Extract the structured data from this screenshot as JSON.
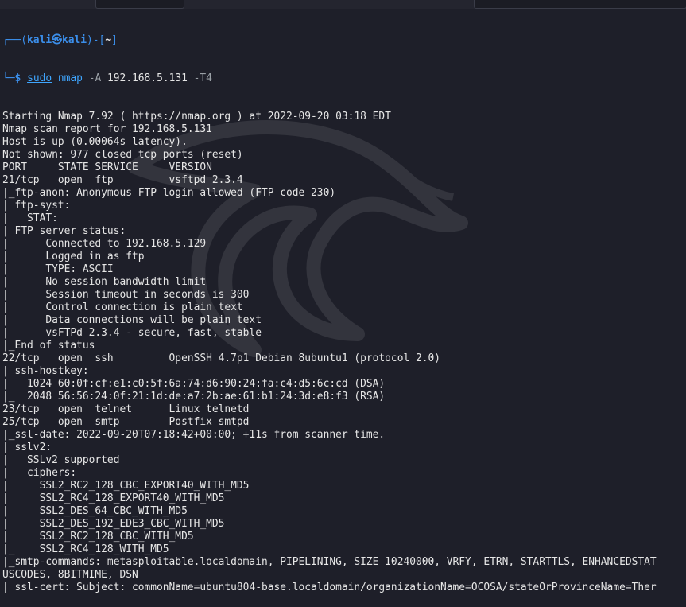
{
  "prompt": {
    "user": "kali",
    "at": "㉿",
    "host": "kali",
    "path": "~",
    "dollar": "$"
  },
  "command": {
    "sudo": "sudo",
    "binary": "nmap",
    "flag_a": "-A",
    "target": "192.168.5.131",
    "flag_t": "-T4"
  },
  "output_lines": [
    "Starting Nmap 7.92 ( https://nmap.org ) at 2022-09-20 03:18 EDT",
    "Nmap scan report for 192.168.5.131",
    "Host is up (0.00064s latency).",
    "Not shown: 977 closed tcp ports (reset)",
    "PORT     STATE SERVICE     VERSION",
    "21/tcp   open  ftp         vsftpd 2.3.4",
    "|_ftp-anon: Anonymous FTP login allowed (FTP code 230)",
    "| ftp-syst:",
    "|   STAT:",
    "| FTP server status:",
    "|      Connected to 192.168.5.129",
    "|      Logged in as ftp",
    "|      TYPE: ASCII",
    "|      No session bandwidth limit",
    "|      Session timeout in seconds is 300",
    "|      Control connection is plain text",
    "|      Data connections will be plain text",
    "|      vsFTPd 2.3.4 - secure, fast, stable",
    "|_End of status",
    "22/tcp   open  ssh         OpenSSH 4.7p1 Debian 8ubuntu1 (protocol 2.0)",
    "| ssh-hostkey:",
    "|   1024 60:0f:cf:e1:c0:5f:6a:74:d6:90:24:fa:c4:d5:6c:cd (DSA)",
    "|_  2048 56:56:24:0f:21:1d:de:a7:2b:ae:61:b1:24:3d:e8:f3 (RSA)",
    "23/tcp   open  telnet      Linux telnetd",
    "25/tcp   open  smtp        Postfix smtpd",
    "|_ssl-date: 2022-09-20T07:18:42+00:00; +11s from scanner time.",
    "| sslv2:",
    "|   SSLv2 supported",
    "|   ciphers:",
    "|     SSL2_RC2_128_CBC_EXPORT40_WITH_MD5",
    "|     SSL2_RC4_128_EXPORT40_WITH_MD5",
    "|     SSL2_DES_64_CBC_WITH_MD5",
    "|     SSL2_DES_192_EDE3_CBC_WITH_MD5",
    "|     SSL2_RC2_128_CBC_WITH_MD5",
    "|_    SSL2_RC4_128_WITH_MD5",
    "|_smtp-commands: metasploitable.localdomain, PIPELINING, SIZE 10240000, VRFY, ETRN, STARTTLS, ENHANCEDSTAT",
    "USCODES, 8BITMIME, DSN",
    "| ssl-cert: Subject: commonName=ubuntu804-base.localdomain/organizationName=OCOSA/stateOrProvinceName=Ther"
  ],
  "colors": {
    "background": "#1e1f29",
    "prompt_accent": "#3b8eea",
    "command": "#3fa6ff",
    "text": "#e6e6e6"
  },
  "icons": {
    "watermark": "kali-dragon-icon"
  }
}
